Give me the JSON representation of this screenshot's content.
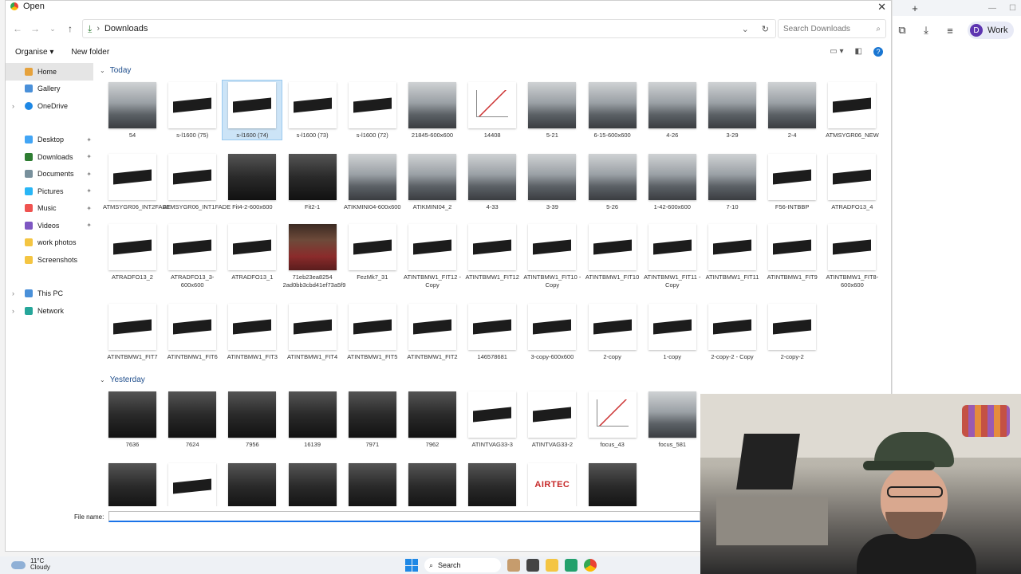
{
  "browser": {
    "tab_new": "+",
    "profile": {
      "initial": "D",
      "label": "Work"
    }
  },
  "dialog": {
    "title": "Open",
    "path_folder": "Downloads",
    "search_placeholder": "Search Downloads",
    "organise": "Organise",
    "new_folder": "New folder",
    "file_name_label": "File name:",
    "file_name_value": ""
  },
  "nav": {
    "home": "Home",
    "gallery": "Gallery",
    "onedrive": "OneDrive",
    "desktop": "Desktop",
    "downloads": "Downloads",
    "documents": "Documents",
    "pictures": "Pictures",
    "music": "Music",
    "videos": "Videos",
    "work_photos": "work photos",
    "screenshots": "Screenshots",
    "this_pc": "This PC",
    "network": "Network"
  },
  "groups": {
    "today": "Today",
    "yesterday": "Yesterday"
  },
  "files_today": [
    [
      "54",
      "s-l1600 (75)",
      "s-l1600 (74)",
      "s-l1600 (73)",
      "s-l1600 (72)",
      "21845-600x600",
      "14408",
      "5-21",
      "6-15-600x600",
      "4-26",
      "3-29",
      "2-4",
      "ATMSYGR06_NEW"
    ],
    [
      "ATMSYGR06_INT2FADE",
      "ATMSYGR06_INT1FADE",
      "Fit4-2-600x600",
      "Fit2-1",
      "ATIKMINI04-600x600",
      "ATIKMINI04_2",
      "4-33",
      "3-39",
      "5-26",
      "1-42-600x600",
      "7-10",
      "F56-INTBBP",
      "ATRADFO13_4"
    ],
    [
      "ATRADFO13_2",
      "ATRADFO13_3-600x600",
      "ATRADFO13_1",
      "71eb23ea8254 2ad0bb3cbd41ef73a5f9",
      "FezMk7_31",
      "ATINTBMW1_FIT12 - Copy",
      "ATINTBMW1_FIT12",
      "ATINTBMW1_FIT10 - Copy",
      "ATINTBMW1_FIT10",
      "ATINTBMW1_FIT11 - Copy",
      "ATINTBMW1_FIT11",
      "ATINTBMW1_FIT9",
      "ATINTBMW1_FIT8-600x600"
    ],
    [
      "ATINTBMW1_FIT7",
      "ATINTBMW1_FIT6",
      "ATINTBMW1_FIT3",
      "ATINTBMW1_FIT4",
      "ATINTBMW1_FIT5",
      "ATINTBMW1_FIT2",
      "146578681",
      "3-copy-600x600",
      "2-copy",
      "1-copy",
      "2-copy-2 - Copy",
      "2-copy-2"
    ]
  ],
  "files_yesterday": [
    [
      "7636",
      "7624",
      "7956",
      "16139",
      "7971",
      "7962",
      "ATINTVAG33-3",
      "ATINTVAG33-2",
      "focus_43",
      "focus_581"
    ]
  ],
  "taskbar": {
    "temp": "11°C",
    "condition": "Cloudy",
    "search": "Search"
  }
}
